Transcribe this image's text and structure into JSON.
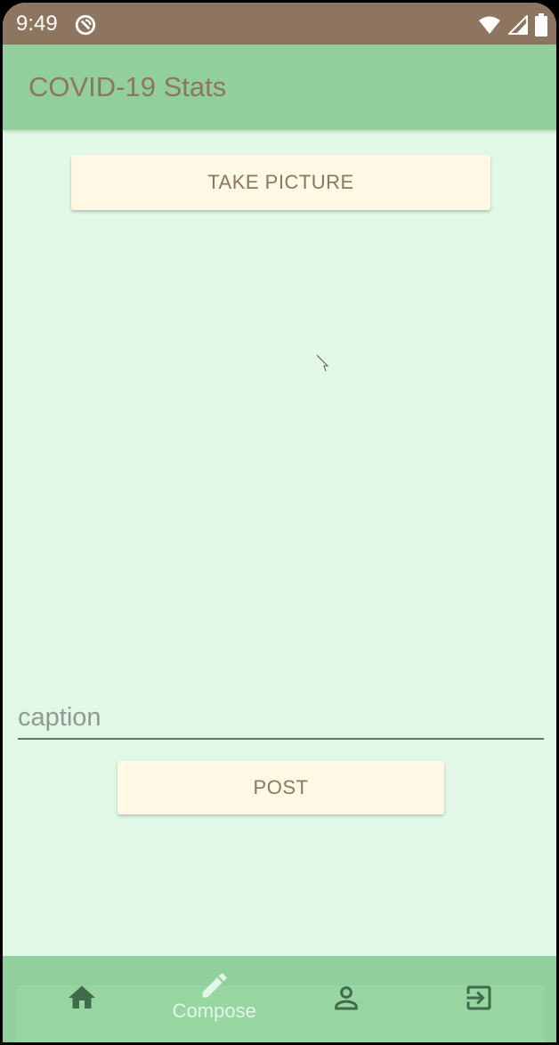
{
  "status_bar": {
    "time": "9:49",
    "icons": [
      "dnd-icon",
      "wifi-icon",
      "signal-icon",
      "battery-icon"
    ]
  },
  "app_bar": {
    "title": "COVID-19 Stats"
  },
  "compose": {
    "take_picture_label": "TAKE PICTURE",
    "caption_placeholder": "caption",
    "caption_value": "",
    "post_label": "POST"
  },
  "bottom_nav": {
    "items": [
      {
        "id": "home",
        "icon": "home-icon",
        "label": ""
      },
      {
        "id": "compose",
        "icon": "pencil-icon",
        "label": "Compose",
        "selected": true
      },
      {
        "id": "profile",
        "icon": "person-icon",
        "label": ""
      },
      {
        "id": "logout",
        "icon": "logout-icon",
        "label": ""
      }
    ]
  },
  "colors": {
    "status_bar": "#8e7560",
    "app_bar": "#91cf9c",
    "background": "#e2f8e7",
    "button_bg": "#fef8e4",
    "accent_text": "#8e7560",
    "nav_icon": "#3f6b4a"
  }
}
